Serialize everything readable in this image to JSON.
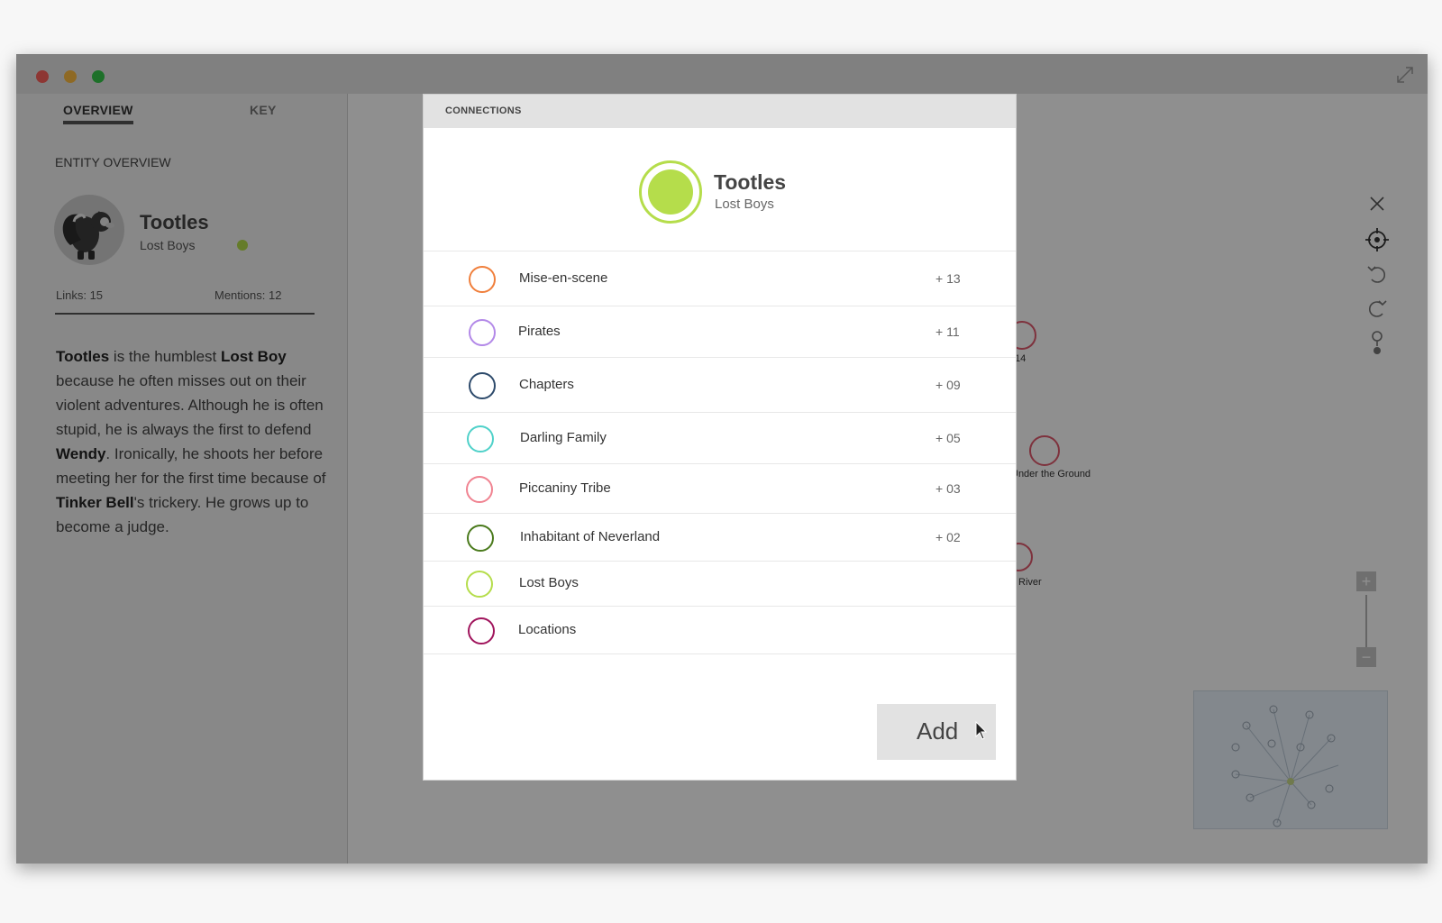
{
  "sidebar": {
    "tabs": [
      "OVERVIEW",
      "KEY"
    ],
    "section_label": "ENTITY OVERVIEW",
    "entity": {
      "name": "Tootles",
      "group": "Lost Boys"
    },
    "links_label": "Links:  15",
    "mentions_label": "Mentions:   12",
    "description": [
      {
        "text": "Tootles",
        "bold": true
      },
      {
        "text": " is the humblest ",
        "bold": false
      },
      {
        "text": "Lost Boy",
        "bold": true
      },
      {
        "text": " because he often misses out on their violent adventures. Although he is often stupid, he is always the first to defend ",
        "bold": false
      },
      {
        "text": "Wendy",
        "bold": true
      },
      {
        "text": ". Ironically, he shoots her before meeting her for the first time because of ",
        "bold": false
      },
      {
        "text": "Tinker Bell",
        "bold": true
      },
      {
        "text": "'s trickery. He grows up to become a judge.",
        "bold": false
      }
    ]
  },
  "graph": {
    "labels": {
      "node_14": "14",
      "under_ground": "Under the Ground",
      "river": "River"
    }
  },
  "zoom": {
    "plus": "+",
    "minus": "−"
  },
  "modal": {
    "title": "CONNECTIONS",
    "entity": {
      "name": "Tootles",
      "group": "Lost Boys",
      "color": "#b5dd4b"
    },
    "connections": [
      {
        "name": "Mise-en-scene",
        "count": "+ 13",
        "color": "#f07f3c"
      },
      {
        "name": "Pirates",
        "count": "+ 11",
        "color": "#b389e8"
      },
      {
        "name": "Chapters",
        "count": "+ 09",
        "color": "#2d4a6b"
      },
      {
        "name": "Darling Family",
        "count": "+ 05",
        "color": "#4fd1c9"
      },
      {
        "name": "Piccaniny Tribe",
        "count": "+ 03",
        "color": "#f08391"
      },
      {
        "name": "Inhabitant of Neverland",
        "count": "+ 02",
        "color": "#4a7a1c"
      },
      {
        "name": "Lost Boys",
        "count": "",
        "color": "#b5dd4b"
      },
      {
        "name": "Locations",
        "count": "",
        "color": "#a0145c"
      }
    ],
    "add_label": "Add"
  }
}
